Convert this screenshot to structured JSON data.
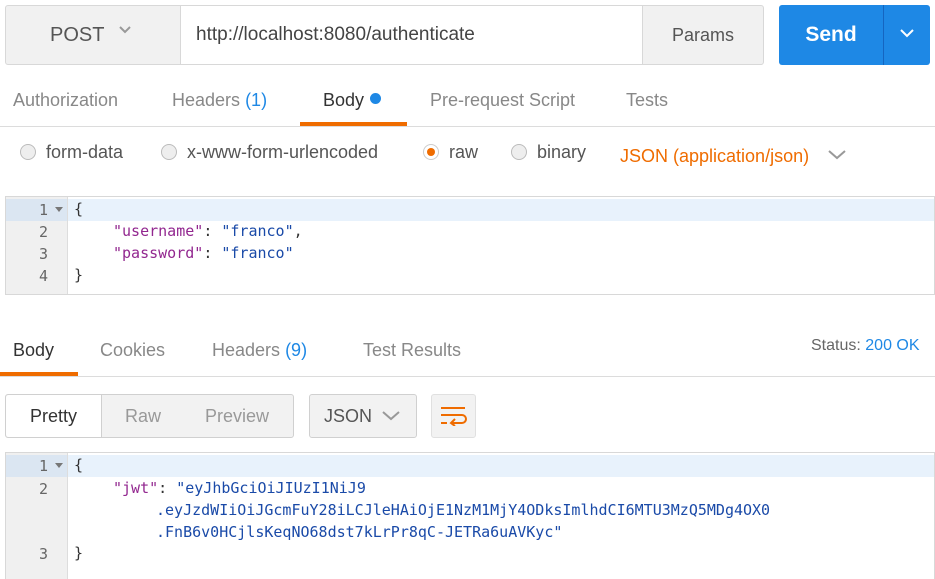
{
  "request": {
    "method": "POST",
    "url": "http://localhost:8080/authenticate",
    "params_label": "Params",
    "send_label": "Send"
  },
  "request_tabs": [
    {
      "label": "Authorization"
    },
    {
      "label": "Headers",
      "count": "(1)"
    },
    {
      "label": "Body"
    },
    {
      "label": "Pre-request Script"
    },
    {
      "label": "Tests"
    }
  ],
  "body_types": {
    "form_data": "form-data",
    "urlencoded": "x-www-form-urlencoded",
    "raw": "raw",
    "binary": "binary",
    "content_type": "JSON (application/json)"
  },
  "request_body": {
    "line_numbers": [
      "1",
      "2",
      "3",
      "4"
    ],
    "brace_open": "{",
    "brace_close": "}",
    "username_key": "\"username\"",
    "username_value": "\"franco\"",
    "password_key": "\"password\"",
    "password_value": "\"franco\""
  },
  "response_tabs": [
    {
      "label": "Body"
    },
    {
      "label": "Cookies"
    },
    {
      "label": "Headers",
      "count": "(9)"
    },
    {
      "label": "Test Results"
    }
  ],
  "status": {
    "label": "Status:",
    "value": "200 OK"
  },
  "view_modes": [
    "Pretty",
    "Raw",
    "Preview"
  ],
  "format": "JSON",
  "response_body": {
    "line_numbers": [
      "1",
      "2",
      "3"
    ],
    "brace_open": "{",
    "brace_close": "}",
    "jwt_key": "\"jwt\"",
    "jwt_line1": "\"eyJhbGciOiJIUzI1NiJ9",
    "jwt_line2": ".eyJzdWIiOiJGcmFuY28iLCJleHAiOjE1NzM1MjY4ODksImlhdCI6MTU3MzQ5MDg4OX0",
    "jwt_line3": ".FnB6v0HCjlsKeqNO68dst7kLrPr8qC-JETRa6uAVKyc\""
  },
  "colors": {
    "accent": "#ef6c00",
    "primary": "#1e88e5"
  }
}
